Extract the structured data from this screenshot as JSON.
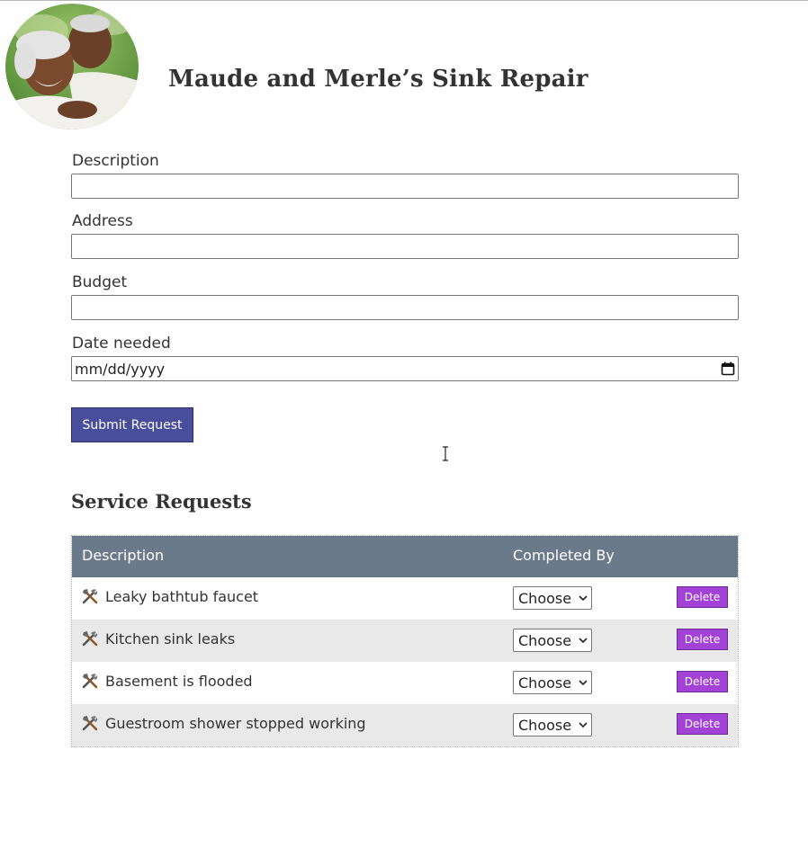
{
  "header": {
    "title": "Maude and Merle’s Sink Repair",
    "avatar_icon": "couple-photo"
  },
  "form": {
    "description": {
      "label": "Description",
      "value": ""
    },
    "address": {
      "label": "Address",
      "value": ""
    },
    "budget": {
      "label": "Budget",
      "value": ""
    },
    "date": {
      "label": "Date needed",
      "value": "mm/dd/yyyy",
      "icon": "calendar-icon"
    },
    "submit_label": "Submit Request"
  },
  "requests": {
    "title": "Service Requests",
    "columns": [
      "Description",
      "Completed By"
    ],
    "rows": [
      {
        "icon": "tools-icon",
        "description": "Leaky bathtub faucet",
        "completed_by": "Choose",
        "delete_label": "Delete"
      },
      {
        "icon": "tools-icon",
        "description": "Kitchen sink leaks",
        "completed_by": "Choose",
        "delete_label": "Delete"
      },
      {
        "icon": "tools-icon",
        "description": "Basement is flooded",
        "completed_by": "Choose",
        "delete_label": "Delete"
      },
      {
        "icon": "tools-icon",
        "description": "Guestroom shower stopped working",
        "completed_by": "Choose",
        "delete_label": "Delete"
      }
    ]
  },
  "colors": {
    "submit_bg": "#484e9b",
    "table_header_bg": "#6b7a8a",
    "delete_bg": "#a342d6",
    "row_alt_bg": "#e9e9e9"
  }
}
